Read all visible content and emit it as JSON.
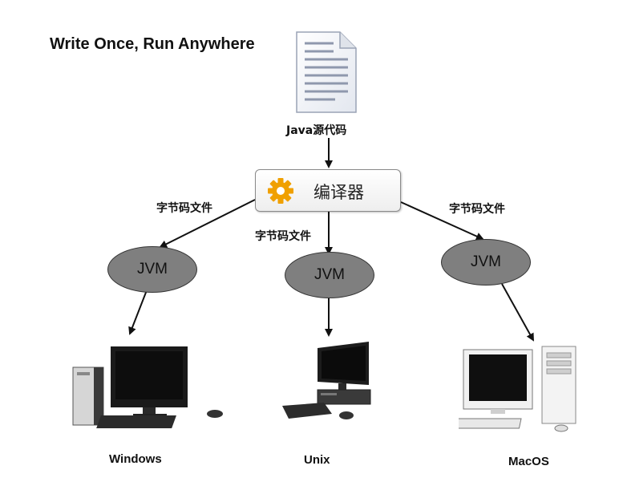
{
  "title": "Write Once, Run Anywhere",
  "source_label": "Java源代码",
  "compiler_label": "编译器",
  "bytecode_labels": [
    "字节码文件",
    "字节码文件",
    "字节码文件"
  ],
  "jvm_labels": [
    "JVM",
    "JVM",
    "JVM"
  ],
  "platforms": [
    "Windows",
    "Unix",
    "MacOS"
  ],
  "icons": {
    "source": "document-icon",
    "compiler": "gear-icon",
    "windows": "desktop-computer-icon",
    "unix": "desktop-computer-icon",
    "macos": "desktop-computer-icon"
  },
  "colors": {
    "gear": "#f0a000",
    "jvm": "#7f7f7f",
    "arrow": "#111111"
  }
}
